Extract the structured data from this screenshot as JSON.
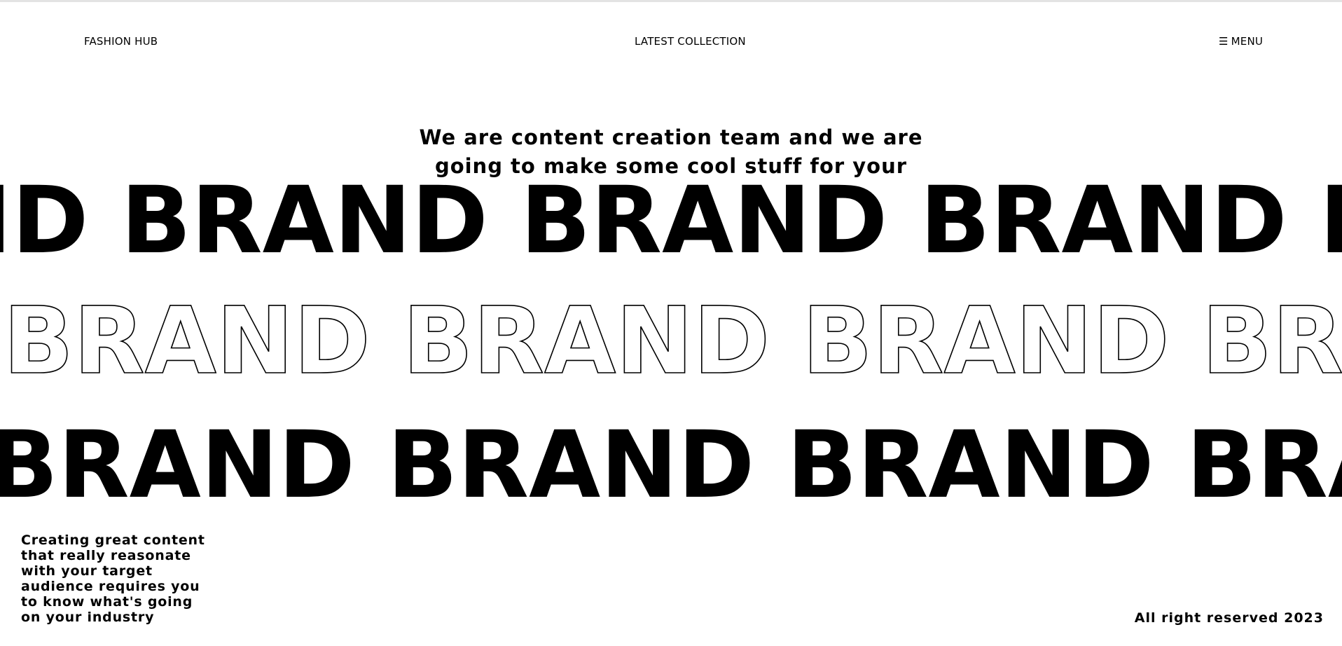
{
  "header": {
    "brand": "FASHION HUB",
    "center_link": "LATEST COLLECTION",
    "menu_label": "MENU",
    "menu_icon": "☰"
  },
  "intro": {
    "line1": "We are content creation team and we are",
    "line2": "going to make some cool stuff for your"
  },
  "marquee": {
    "word": "BRAND",
    "rows": [
      {
        "style": "filled"
      },
      {
        "style": "outline"
      },
      {
        "style": "filled"
      }
    ]
  },
  "blurb": {
    "lines": [
      "Creating great content",
      "that really reasonate",
      "with your target",
      "audience requires you",
      "to know what's going",
      "on your industry"
    ]
  },
  "footer": {
    "rights": "All right reserved 2023"
  },
  "colors": {
    "background": "#ffffff",
    "text": "#000000",
    "top_rule": "#e3e3e3"
  }
}
